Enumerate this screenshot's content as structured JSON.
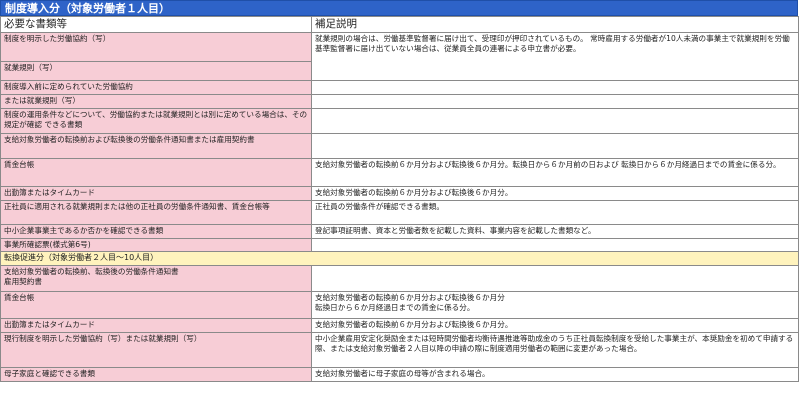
{
  "title": "制度導入分（対象労働者１人目）",
  "headers": {
    "documents": "必要な書類等",
    "notes": "補足説明"
  },
  "rows": [
    {
      "type": "row",
      "h": 29,
      "doc": "制度を明示した労働協約（写）",
      "note": "就業規則の場合は、労働基準監督署に届け出て、受理印が押印されているもの。 常時雇用する労働者が10人未満の事業主で就業規則を労働基準監督署に届け出ていない場合は、従業員全員の連署による申立書が必要。",
      "rowspan": 2
    },
    {
      "type": "row",
      "h": 19,
      "doc": "就業規則（写）"
    },
    {
      "type": "row",
      "h": 14,
      "doc": "制度導入前に定められていた労働協約",
      "note": ""
    },
    {
      "type": "row",
      "h": 14,
      "doc": "または就業規則（写）",
      "note": ""
    },
    {
      "type": "row",
      "h": 25,
      "doc": "制度の運用条件などについて、労働協約または就業規則とは別に定めている場合は、その規定が確認 できる書類",
      "note": ""
    },
    {
      "type": "row",
      "h": 25,
      "doc": "支給対象労働者の転換前および転換後の労働条件通知書または雇用契約書",
      "note": ""
    },
    {
      "type": "row",
      "h": 28,
      "doc": "賃金台帳",
      "note": "支給対象労働者の転換前６か月分および転換後６か月分。転換日から６か月前の日および 転換日から６か月経過日までの賃金に係る分。"
    },
    {
      "type": "row",
      "h": 14,
      "doc": "出勤簿またはタイムカード",
      "note": "支給対象労働者の転換前６か月分および転換後６か月分。"
    },
    {
      "type": "row",
      "h": 24,
      "doc": "正社員に適用される就業規則または他の正社員の労働条件通知書、賃金台帳等",
      "note": "正社員の労働条件が確認できる書類。"
    },
    {
      "type": "row",
      "h": 14,
      "doc": "中小企業事業主であるか否かを確認できる書類",
      "note": "登記事項証明書、資本と労働者数を記載した資料、事業内容を記載した書類など。"
    },
    {
      "type": "row",
      "h": 13,
      "doc": "事業所確認票(様式第6号)",
      "note": ""
    },
    {
      "type": "section",
      "h": 14,
      "label": "転換促進分（対象労働者２人目〜10人目）"
    },
    {
      "type": "row",
      "h": 26,
      "doc": "支給対象労働者の転換前、転換後の労働条件通知書\n雇用契約書",
      "note": ""
    },
    {
      "type": "row",
      "h": 27,
      "doc": "賃金台帳",
      "note": "支給対象労働者の転換前６か月分および転換後６か月分\n 転換日から６か月経過日までの賃金に係る分。"
    },
    {
      "type": "row",
      "h": 14,
      "doc": "出勤簿またはタイムカード",
      "note": "支給対象労働者の転換前６か月分および転換後６か月分。"
    },
    {
      "type": "row",
      "h": 35,
      "doc": "現行制度を明示した労働協約（写）または就業規則（写）",
      "note": "中小企業雇用安定化奨励金または短時間労働者均衡待遇推進等助成金のうち正社員転換制度を受給した事業主が、本奨励金を初めて申請する際、または支給対象労働者２人目以降の申請の際に制度適用労働者の範囲に変更があった場合。"
    },
    {
      "type": "row",
      "h": 14,
      "doc": "母子家庭と確認できる書類",
      "note": "支給対象労働者に母子家庭の母等が含まれる場合。"
    }
  ],
  "colors": {
    "title_bg": "#2e63c8",
    "doc_bg": "#f7cdd6",
    "section_bg": "#fff3bd"
  }
}
